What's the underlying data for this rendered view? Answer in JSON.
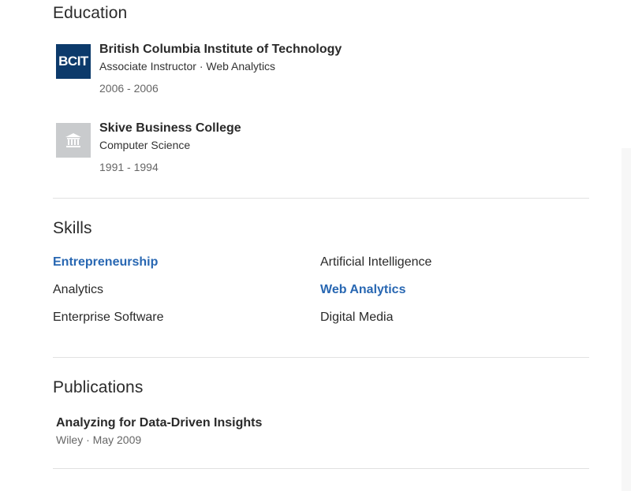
{
  "education": {
    "title": "Education",
    "items": [
      {
        "logo_text": "BCIT",
        "logo_icon": "bcit-logo",
        "school": "British Columbia Institute of Technology",
        "degree": "Associate Instructor · Web Analytics",
        "dates": "2006 - 2006"
      },
      {
        "logo_text": "",
        "logo_icon": "building-icon",
        "school": "Skive Business College",
        "degree": "Computer Science",
        "dates": "1991 - 1994"
      }
    ]
  },
  "skills": {
    "title": "Skills",
    "items": [
      {
        "label": "Entrepreneurship",
        "is_link": true
      },
      {
        "label": "Artificial Intelligence",
        "is_link": false
      },
      {
        "label": "Analytics",
        "is_link": false
      },
      {
        "label": "Web Analytics",
        "is_link": true
      },
      {
        "label": "Enterprise Software",
        "is_link": false
      },
      {
        "label": "Digital Media",
        "is_link": false
      }
    ]
  },
  "publications": {
    "title": "Publications",
    "items": [
      {
        "title": "Analyzing for Data-Driven Insights",
        "meta": "Wiley · May 2009"
      }
    ]
  },
  "colors": {
    "link": "#2867b2",
    "bcit_logo_bg": "#0c3a6b",
    "generic_logo_bg": "#c9cbcd"
  }
}
